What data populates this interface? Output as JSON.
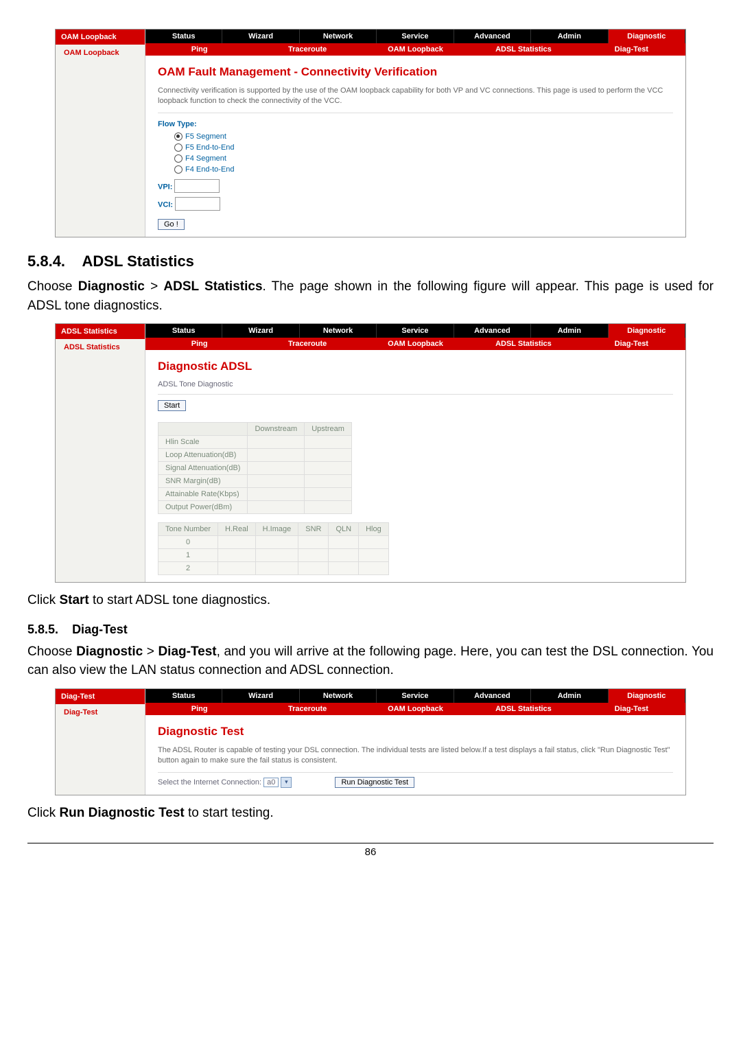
{
  "nav": {
    "row1": [
      "Status",
      "Wizard",
      "Network",
      "Service",
      "Advanced",
      "Admin",
      "Diagnostic"
    ],
    "row2": [
      "Ping",
      "Traceroute",
      "OAM Loopback",
      "ADSL Statistics",
      "Diag-Test"
    ]
  },
  "shot1": {
    "sidebarTitle": "OAM Loopback",
    "sidebarItem": "OAM Loopback",
    "heading": "OAM Fault Management - Connectivity Verification",
    "descr": "Connectivity verification is supported by the use of the OAM loopback capability for both VP and VC connections. This page is used to perform the VCC loopback function to check the connectivity of the VCC.",
    "flowType": "Flow Type:",
    "radios": [
      "F5 Segment",
      "F5 End-to-End",
      "F4 Segment",
      "F4 End-to-End"
    ],
    "vpi": "VPI:",
    "vci": "VCI:",
    "go": "Go !"
  },
  "sec584": {
    "num": "5.8.4.",
    "title": "ADSL Statistics",
    "para": "Choose Diagnostic > ADSL Statistics. The page shown in the following figure will appear. This page is used for ADSL tone diagnostics."
  },
  "shot2": {
    "sidebarTitle": "ADSL Statistics",
    "sidebarItem": "ADSL Statistics",
    "heading": "Diagnostic ADSL",
    "subhead": "ADSL Tone Diagnostic",
    "start": "Start",
    "cols": [
      "",
      "Downstream",
      "Upstream"
    ],
    "rows": [
      "Hlin Scale",
      "Loop Attenuation(dB)",
      "Signal Attenuation(dB)",
      "SNR Margin(dB)",
      "Attainable Rate(Kbps)",
      "Output Power(dBm)"
    ],
    "toneHeaders": [
      "Tone Number",
      "H.Real",
      "H.Image",
      "SNR",
      "QLN",
      "Hlog"
    ],
    "toneRows": [
      "0",
      "1",
      "2"
    ]
  },
  "afterShot2": "Click Start to start ADSL tone diagnostics.",
  "sec585": {
    "num": "5.8.5.",
    "title": "Diag-Test",
    "para": "Choose Diagnostic > Diag-Test, and you will arrive at the following page. Here, you can test the DSL connection. You can also view the LAN status connection and ADSL connection."
  },
  "shot3": {
    "sidebarTitle": "Diag-Test",
    "sidebarItem": "Diag-Test",
    "heading": "Diagnostic Test",
    "descr": "The ADSL Router is capable of testing your DSL connection. The individual tests are listed below.If a test displays a fail status, click \"Run Diagnostic Test\" button again to make sure the fail status is consistent.",
    "selectLabel": "Select the Internet Connection:",
    "selectValue": "a0",
    "runBtn": "Run Diagnostic Test"
  },
  "afterShot3": "Click Run Diagnostic Test to start testing.",
  "pagenum": "86",
  "chart_data": {
    "type": "table",
    "title": "ADSL Tone Diagnostic metrics",
    "categories": [
      "Downstream",
      "Upstream"
    ],
    "series": [
      {
        "name": "Hlin Scale",
        "values": [
          null,
          null
        ]
      },
      {
        "name": "Loop Attenuation(dB)",
        "values": [
          null,
          null
        ]
      },
      {
        "name": "Signal Attenuation(dB)",
        "values": [
          null,
          null
        ]
      },
      {
        "name": "SNR Margin(dB)",
        "values": [
          null,
          null
        ]
      },
      {
        "name": "Attainable Rate(Kbps)",
        "values": [
          null,
          null
        ]
      },
      {
        "name": "Output Power(dBm)",
        "values": [
          null,
          null
        ]
      }
    ]
  }
}
